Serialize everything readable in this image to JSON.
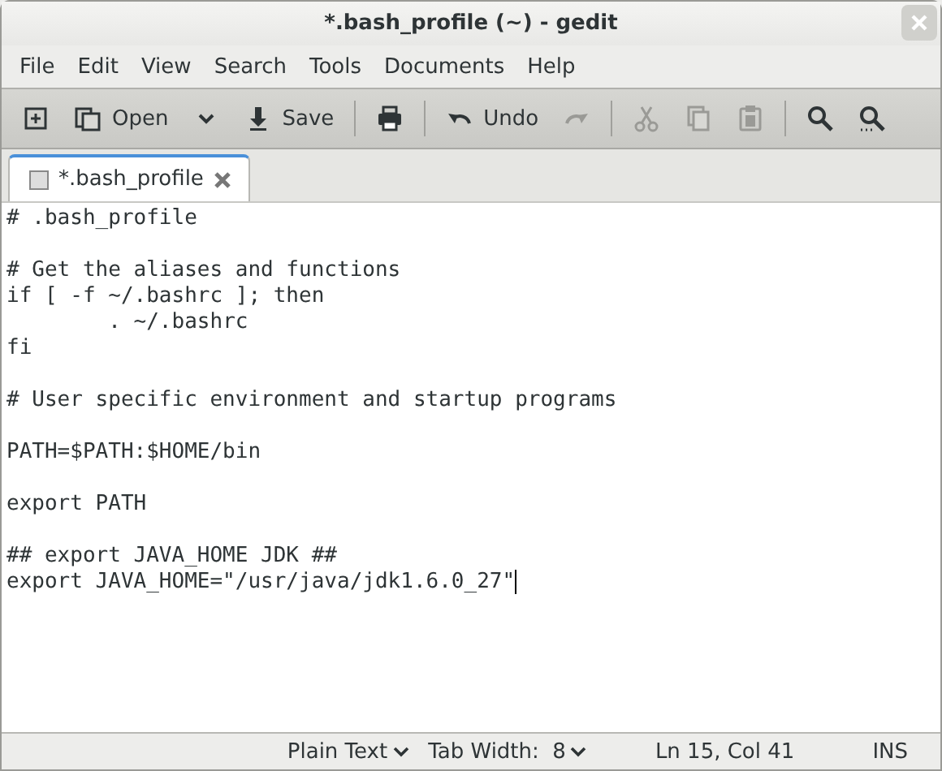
{
  "window": {
    "title": "*.bash_profile (~) - gedit"
  },
  "menu": [
    "File",
    "Edit",
    "View",
    "Search",
    "Tools",
    "Documents",
    "Help"
  ],
  "toolbar": [
    {
      "kind": "new",
      "disabled": false
    },
    {
      "kind": "open",
      "label": "Open",
      "disabled": false
    },
    {
      "kind": "dropdown",
      "disabled": false
    },
    {
      "kind": "save",
      "label": "Save",
      "disabled": false
    },
    {
      "kind": "sep"
    },
    {
      "kind": "print",
      "disabled": false
    },
    {
      "kind": "sep"
    },
    {
      "kind": "undo",
      "label": "Undo",
      "disabled": false
    },
    {
      "kind": "redo",
      "disabled": true
    },
    {
      "kind": "sep"
    },
    {
      "kind": "cut",
      "disabled": true
    },
    {
      "kind": "copy",
      "disabled": true
    },
    {
      "kind": "paste",
      "disabled": true
    },
    {
      "kind": "sep"
    },
    {
      "kind": "find",
      "disabled": false
    },
    {
      "kind": "replace",
      "disabled": false
    }
  ],
  "tabs": [
    {
      "label": "*.bash_profile",
      "selected": true
    }
  ],
  "editor": {
    "paragraphs": [
      {
        "lines": [
          "# .bash_profile"
        ]
      },
      {
        "lines": [
          "# Get the aliases and functions",
          "if [ -f ~/.bashrc ]; then",
          "\t. ~/.bashrc",
          "fi"
        ]
      },
      {
        "lines": [
          "# User specific environment and startup programs"
        ]
      },
      {
        "lines": [
          "PATH=$PATH:$HOME/bin"
        ]
      },
      {
        "lines": [
          "export PATH"
        ]
      },
      {
        "lines": [
          "## export JAVA_HOME JDK ##",
          "export JAVA_HOME=\"/usr/java/jdk1.6.0_27\""
        ]
      }
    ]
  },
  "status_bar": {
    "language": "Plain Text",
    "tab_width": "Tab Width:  8",
    "position": "Ln 15, Col 41",
    "mode": "INS"
  }
}
